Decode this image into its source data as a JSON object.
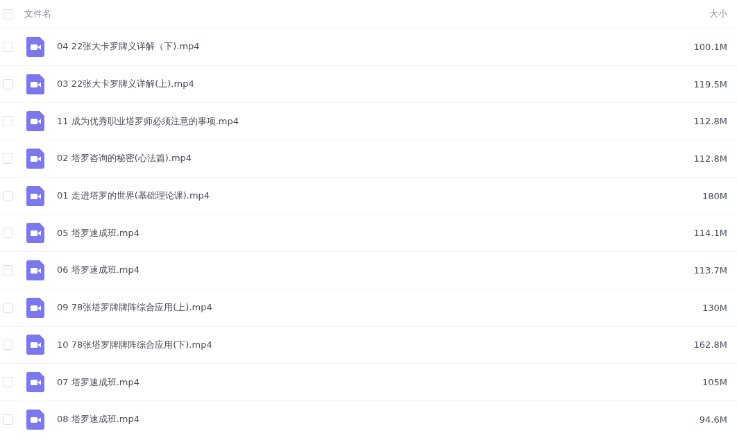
{
  "header": {
    "checked": false,
    "name_label": "文件名",
    "size_label": "大小"
  },
  "files": [
    {
      "name": "04 22张大卡罗牌义详解（下).mp4",
      "size": "100.1M",
      "checked": false
    },
    {
      "name": "03 22张大卡罗牌义详解(上).mp4",
      "size": "119.5M",
      "checked": false
    },
    {
      "name": "11 成为优秀职业塔罗师必须注意的事项.mp4",
      "size": "112.8M",
      "checked": false
    },
    {
      "name": "02 塔罗咨询的秘密(心法篇).mp4",
      "size": "112.8M",
      "checked": false
    },
    {
      "name": "01 走进塔罗的世界(基础理论课).mp4",
      "size": "180M",
      "checked": false
    },
    {
      "name": "05 塔罗速成班.mp4",
      "size": "114.1M",
      "checked": false
    },
    {
      "name": "06 塔罗速成班.mp4",
      "size": "113.7M",
      "checked": false
    },
    {
      "name": "09 78张塔罗牌牌阵综合应用(上).mp4",
      "size": "130M",
      "checked": false
    },
    {
      "name": "10 78张塔罗牌牌阵综合应用(下).mp4",
      "size": "162.8M",
      "checked": false
    },
    {
      "name": "07 塔罗速成班.mp4",
      "size": "105M",
      "checked": false
    },
    {
      "name": "08 塔罗速成班.mp4",
      "size": "94.6M",
      "checked": false
    }
  ]
}
